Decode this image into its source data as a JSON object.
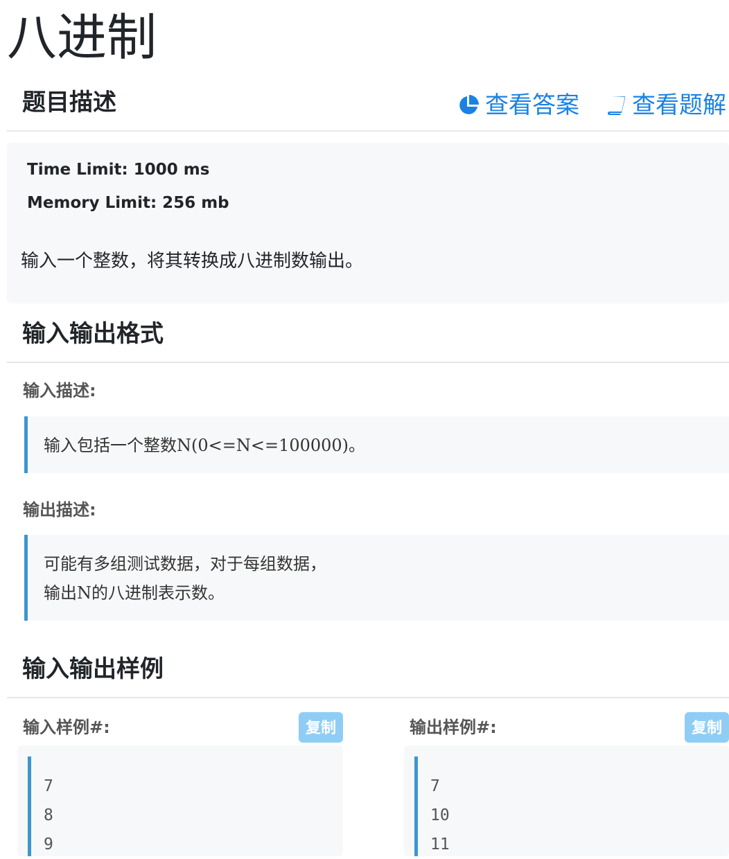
{
  "page_title": "八进制",
  "description": {
    "heading": "题目描述",
    "links": {
      "answer": "查看答案",
      "solution": "查看题解"
    },
    "time_limit": "Time Limit: 1000 ms",
    "memory_limit": "Memory Limit: 256 mb",
    "text": "输入一个整数，将其转换成八进制数输出。"
  },
  "io_format": {
    "heading": "输入输出格式",
    "input_label": "输入描述:",
    "input_text": "输入包括一个整数N(0<=N<=100000)。",
    "output_label": "输出描述:",
    "output_lines": [
      "可能有多组测试数据，对于每组数据，",
      "输出N的八进制表示数。"
    ]
  },
  "samples": {
    "heading": "输入输出样例",
    "input_label": "输入样例#:",
    "output_label": "输出样例#:",
    "copy_label": "复制",
    "input_lines": [
      "7",
      "8",
      "9"
    ],
    "output_lines": [
      "7",
      "10",
      "11"
    ]
  },
  "colors": {
    "link": "#1a82e2",
    "accent_border": "#3c96d1",
    "copy_button": "#8fcdf4",
    "panel_bg": "#f7f8fa"
  },
  "icons": {
    "answer": "pie-chart-icon",
    "solution": "book-icon"
  }
}
